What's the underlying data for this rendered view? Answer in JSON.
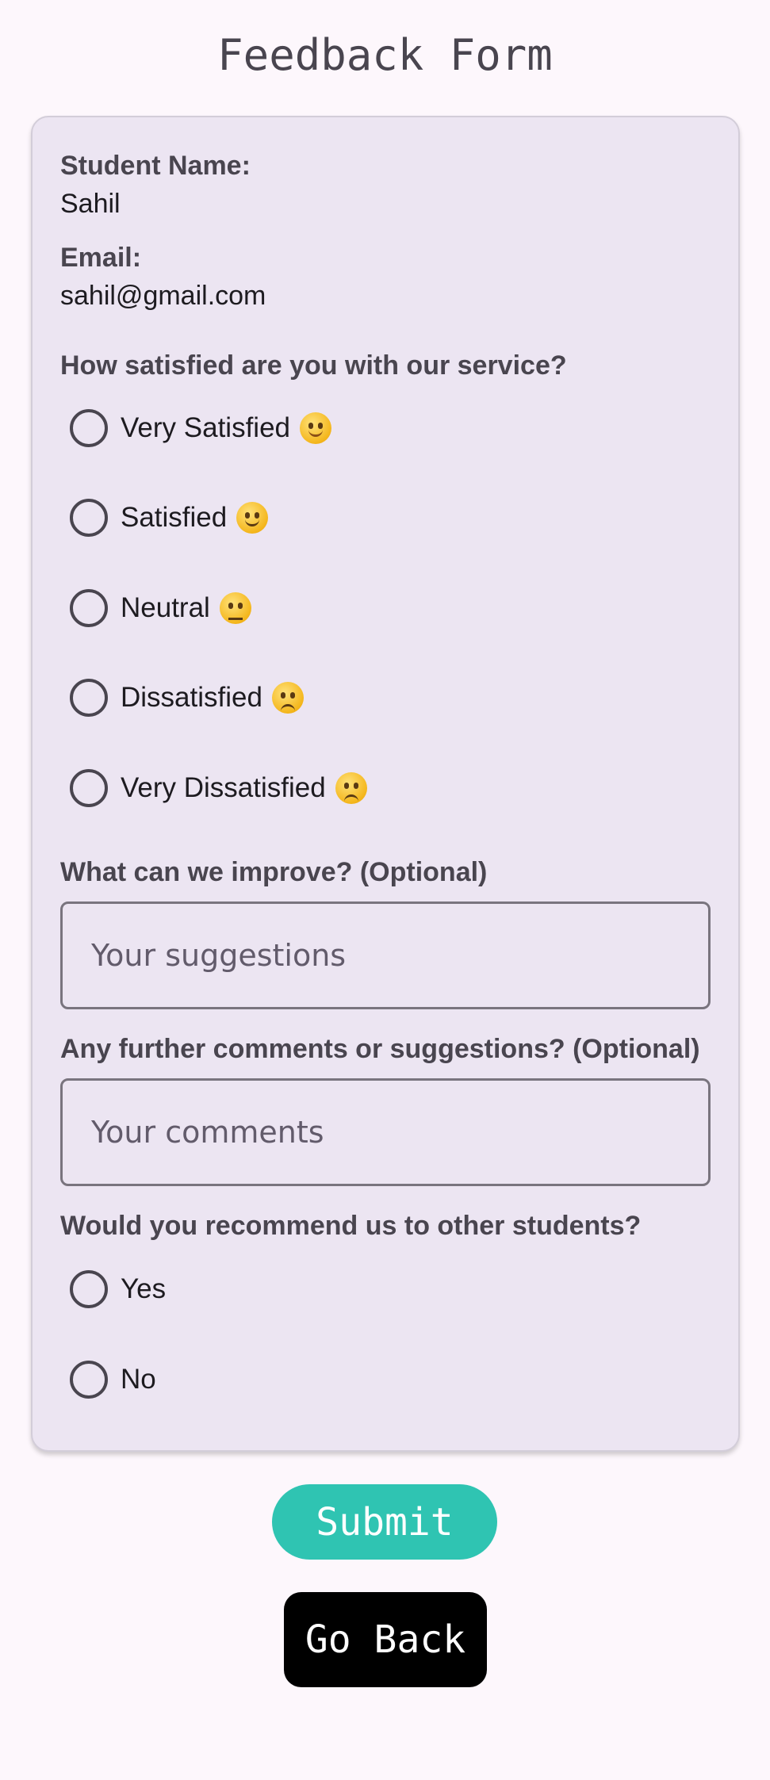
{
  "page": {
    "title": "Feedback Form"
  },
  "student": {
    "name_label": "Student Name:",
    "name_value": "Sahil",
    "email_label": "Email:",
    "email_value": "sahil@gmail.com"
  },
  "satisfaction": {
    "question": "How satisfied are you with our service?",
    "options": [
      {
        "label": "Very Satisfied",
        "emoji": "blush-smile-icon",
        "selected": false
      },
      {
        "label": "Satisfied",
        "emoji": "slight-smile-icon",
        "selected": false
      },
      {
        "label": "Neutral",
        "emoji": "neutral-face-icon",
        "selected": false
      },
      {
        "label": "Dissatisfied",
        "emoji": "slight-frown-icon",
        "selected": false
      },
      {
        "label": "Very Dissatisfied",
        "emoji": "disappointed-face-icon",
        "selected": false
      }
    ]
  },
  "improve": {
    "question": "What can we improve? (Optional)",
    "placeholder": "Your suggestions",
    "value": ""
  },
  "comments": {
    "question": "Any further comments or suggestions? (Optional)",
    "placeholder": "Your comments",
    "value": ""
  },
  "recommend": {
    "question": "Would you recommend us to other students?",
    "options": [
      {
        "label": "Yes",
        "selected": false
      },
      {
        "label": "No",
        "selected": false
      }
    ]
  },
  "actions": {
    "submit_label": "Submit",
    "back_label": "Go Back"
  },
  "colors": {
    "background": "#fdf7fc",
    "card": "#ece5f2",
    "submit": "#2fc4b2",
    "back": "#000000"
  }
}
